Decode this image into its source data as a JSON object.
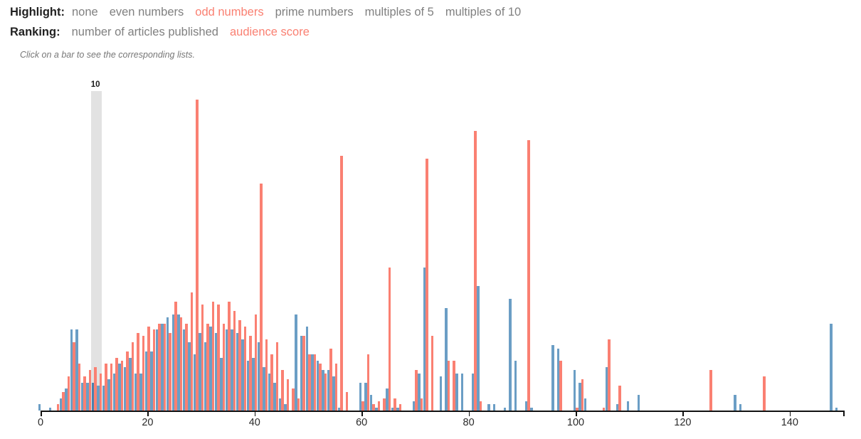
{
  "controls": {
    "highlight": {
      "label": "Highlight:",
      "options": [
        {
          "label": "none",
          "active": false
        },
        {
          "label": "even numbers",
          "active": false
        },
        {
          "label": "odd numbers",
          "active": true
        },
        {
          "label": "prime numbers",
          "active": false
        },
        {
          "label": "multiples of 5",
          "active": false
        },
        {
          "label": "multiples of 10",
          "active": false
        }
      ]
    },
    "ranking": {
      "label": "Ranking:",
      "options": [
        {
          "label": "number of articles published",
          "active": false
        },
        {
          "label": "audience score",
          "active": true
        }
      ]
    },
    "hint": "Click on a bar to see the corresponding lists."
  },
  "colors": {
    "blue": "#6b9ec5",
    "blue_selected": "#4a81ae",
    "red": "#fa8072",
    "highlight_band": "#e2e2e2",
    "accent": "#fa8072",
    "axis": "#111111"
  },
  "selection": {
    "value": 10,
    "label": "10"
  },
  "chart_data": {
    "type": "bar",
    "title": "",
    "xlabel": "",
    "ylabel": "",
    "xlim": [
      0,
      150
    ],
    "ylim": [
      0,
      100
    ],
    "grid": false,
    "legend": false,
    "x_ticks": [
      0,
      20,
      40,
      60,
      80,
      100,
      120,
      140
    ],
    "x_tick_labels": [
      "0",
      "20",
      "40",
      "60",
      "80",
      "100",
      "120",
      "140"
    ],
    "x": [
      0,
      1,
      2,
      3,
      4,
      5,
      6,
      7,
      8,
      9,
      10,
      11,
      12,
      13,
      14,
      15,
      16,
      17,
      18,
      19,
      20,
      21,
      22,
      23,
      24,
      25,
      26,
      27,
      28,
      29,
      30,
      31,
      32,
      33,
      34,
      35,
      36,
      37,
      38,
      39,
      40,
      41,
      42,
      43,
      44,
      45,
      46,
      47,
      48,
      49,
      50,
      51,
      52,
      53,
      54,
      55,
      56,
      57,
      58,
      59,
      60,
      61,
      62,
      63,
      64,
      65,
      66,
      67,
      68,
      69,
      70,
      71,
      72,
      73,
      74,
      75,
      76,
      77,
      78,
      79,
      80,
      81,
      82,
      83,
      84,
      85,
      86,
      87,
      88,
      89,
      90,
      91,
      92,
      93,
      94,
      95,
      96,
      97,
      98,
      99,
      100,
      101,
      102,
      103,
      104,
      105,
      106,
      107,
      108,
      109,
      110,
      111,
      112,
      113,
      114,
      115,
      116,
      117,
      118,
      119,
      120,
      121,
      122,
      123,
      124,
      125,
      126,
      127,
      128,
      129,
      130,
      131,
      132,
      133,
      134,
      135,
      136,
      137,
      138,
      139,
      140,
      141,
      142,
      143,
      144,
      145,
      146,
      147,
      148,
      149
    ],
    "series": [
      {
        "name": "number of articles published",
        "color": "#6b9ec5",
        "values": [
          2,
          0,
          1,
          0,
          4,
          7,
          26,
          26,
          9,
          9,
          9,
          8,
          8,
          10,
          12,
          15,
          14,
          17,
          12,
          12,
          19,
          19,
          26,
          28,
          30,
          31,
          31,
          26,
          22,
          18,
          25,
          22,
          27,
          25,
          17,
          26,
          26,
          25,
          23,
          16,
          17,
          22,
          14,
          12,
          9,
          4,
          2,
          0,
          31,
          24,
          27,
          18,
          16,
          13,
          13,
          11,
          1,
          0,
          0,
          0,
          9,
          9,
          5,
          1,
          0,
          7,
          1,
          1,
          0,
          0,
          3,
          12,
          46,
          0,
          0,
          11,
          33,
          0,
          12,
          12,
          0,
          12,
          40,
          0,
          2,
          2,
          0,
          1,
          36,
          16,
          0,
          3,
          1,
          0,
          0,
          0,
          21,
          20,
          0,
          0,
          13,
          9,
          4,
          0,
          0,
          0,
          14,
          0,
          2,
          0,
          3,
          0,
          5,
          0,
          0,
          0,
          0,
          0,
          0,
          0,
          0,
          0,
          0,
          0,
          0,
          0,
          0,
          0,
          0,
          0,
          5,
          2,
          0,
          0,
          0,
          0,
          0,
          0,
          0,
          0,
          0,
          0,
          0,
          0,
          0,
          0,
          0,
          0,
          28,
          1
        ]
      },
      {
        "name": "audience score",
        "color": "#fa8072",
        "values": [
          0,
          0,
          0,
          2,
          6,
          11,
          22,
          15,
          11,
          13,
          14,
          12,
          15,
          15,
          17,
          16,
          19,
          22,
          25,
          24,
          27,
          26,
          28,
          28,
          25,
          35,
          30,
          28,
          38,
          100,
          34,
          28,
          35,
          34,
          28,
          35,
          32,
          29,
          27,
          24,
          31,
          73,
          23,
          18,
          22,
          13,
          10,
          7,
          4,
          24,
          18,
          18,
          15,
          12,
          20,
          15,
          82,
          6,
          0,
          0,
          3,
          18,
          2,
          3,
          4,
          46,
          4,
          2,
          0,
          0,
          13,
          4,
          81,
          24,
          0,
          0,
          16,
          16,
          0,
          0,
          0,
          90,
          3,
          0,
          0,
          0,
          0,
          0,
          0,
          0,
          0,
          87,
          0,
          0,
          0,
          0,
          0,
          16,
          0,
          0,
          1,
          10,
          0,
          0,
          0,
          1,
          23,
          0,
          8,
          0,
          0,
          0,
          0,
          0,
          0,
          0,
          0,
          0,
          0,
          0,
          0,
          0,
          0,
          0,
          0,
          13,
          0,
          0,
          0,
          0,
          0,
          0,
          0,
          0,
          0,
          11,
          0,
          0,
          0,
          0,
          0,
          0,
          0,
          0,
          0,
          0,
          0,
          0,
          0,
          0
        ]
      }
    ]
  }
}
